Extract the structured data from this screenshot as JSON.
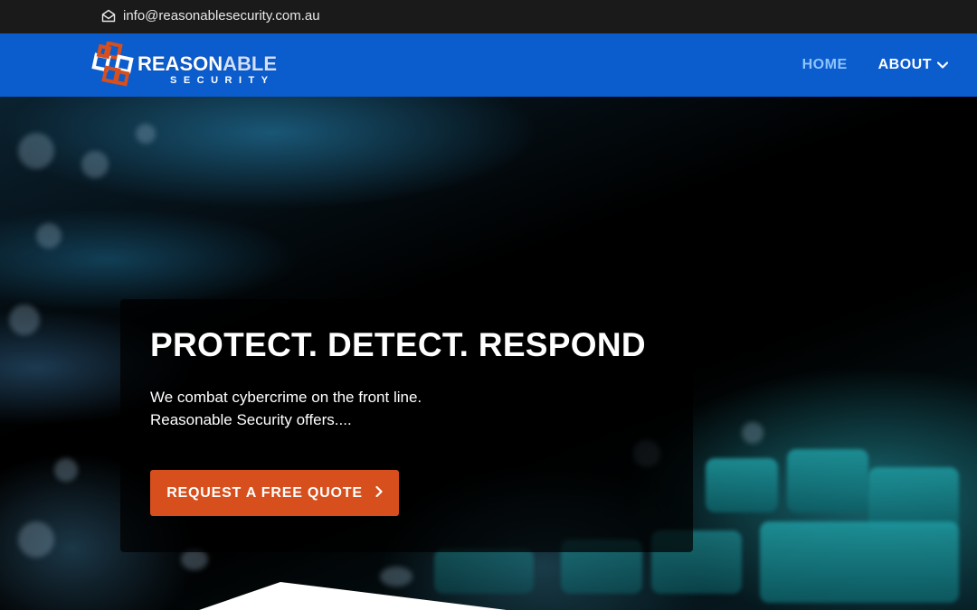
{
  "topbar": {
    "email": "info@reasonablesecurity.com.au",
    "email_icon": "envelope-open-icon"
  },
  "header": {
    "logo": {
      "word_main": "REASON",
      "word_highlight": "ABLE",
      "word_sub": "SECURITY",
      "mark_icon": "interlocked-squares-logo"
    },
    "nav": {
      "home": "HOME",
      "about": "ABOUT",
      "about_icon": "chevron-down-icon"
    },
    "colors": {
      "header_bg": "#0b5ccd",
      "home_active": "#8ec4ff",
      "topbar_bg": "#1a1a1a"
    }
  },
  "hero": {
    "headline": "PROTECT. DETECT. RESPOND",
    "line1": "We combat cybercrime on the front line.",
    "line2": "Reasonable Security offers....",
    "cta_label": "REQUEST A FREE QUOTE",
    "cta_icon": "chevron-right-icon",
    "cta_color": "#d64f1c"
  }
}
